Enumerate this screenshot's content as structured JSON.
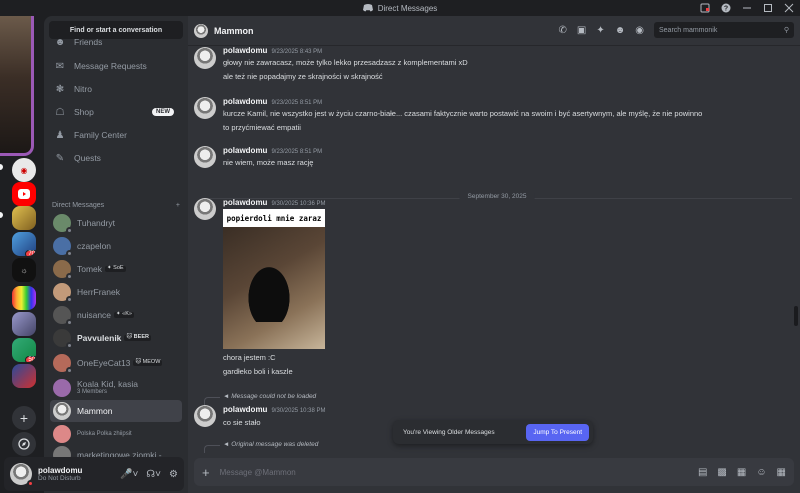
{
  "titlebar": {
    "title": "Direct Messages"
  },
  "rail": {
    "badges": [
      "70",
      "50"
    ]
  },
  "sidebar": {
    "search_label": "Find or start a conversation",
    "nav": [
      {
        "label": "Friends",
        "icon": "friends-icon"
      },
      {
        "label": "Message Requests",
        "icon": "mail-icon"
      },
      {
        "label": "Nitro",
        "icon": "nitro-icon"
      },
      {
        "label": "Shop",
        "icon": "shop-icon",
        "badge": "NEW"
      },
      {
        "label": "Family Center",
        "icon": "family-icon"
      },
      {
        "label": "Quests",
        "icon": "quests-icon"
      }
    ],
    "dm_header": "Direct Messages",
    "dm_add": "+",
    "dms": [
      {
        "name": "Tuhandryt"
      },
      {
        "name": "czapelon"
      },
      {
        "name": "Tomek",
        "tag": "✦ SoE"
      },
      {
        "name": "HerrFranek"
      },
      {
        "name": "nuisance",
        "tag": "✦ «K»"
      },
      {
        "name": "Pavvulenik",
        "tag": "🐱 BEER"
      },
      {
        "name": "OneEyeCat13",
        "tag": "🐱 MEOW"
      },
      {
        "name": "Koala Kid, kasia",
        "sub": "3 Members"
      },
      {
        "name": "Mammon"
      },
      {
        "name": "Polska Polka zhiipsit"
      },
      {
        "name": "marketingowe ziomki - ..."
      }
    ]
  },
  "user": {
    "name": "polawdomu",
    "status": "Do Not Disturb"
  },
  "chat": {
    "channel": "Mammon",
    "search_placeholder": "Search mammonik",
    "messages": [
      {
        "author": "polawdomu",
        "time": "9/23/2025 8:43 PM",
        "lines": [
          "głowy nie zawracasz, może tylko lekko przesadzasz z komplementami xD",
          "ale też nie popadajmy ze skrajności w skrajność"
        ]
      },
      {
        "author": "polawdomu",
        "time": "9/23/2025 8:51 PM",
        "lines": [
          "kurcze Kamil, nie wszystko jest w życiu czarno-białe... czasami faktycznie warto postawić na swoim i być asertywnym, ale myślę, że nie powinno",
          "to przyćmiewać empatii"
        ]
      },
      {
        "author": "polawdomu",
        "time": "9/23/2025 8:51 PM",
        "lines": [
          "nie wiem, może masz rację"
        ]
      },
      {
        "author": "polawdomu",
        "time": "9/30/2025 10:36 PM",
        "lines": [
          "chora jestem :C",
          "gardłeko boli i kaszle"
        ],
        "image_caption": "popierdoli mnie zaraz"
      },
      {
        "author": "polawdomu",
        "time": "9/30/2025 10:38 PM",
        "reply": "Message could not be loaded",
        "lines": [
          "co sie stało"
        ]
      }
    ],
    "date_divider": "September 30, 2025",
    "deleted_reply": "Original message was deleted",
    "older_text": "You're Viewing Older Messages",
    "jump_label": "Jump To Present",
    "composer_placeholder": "Message @Mammon"
  }
}
